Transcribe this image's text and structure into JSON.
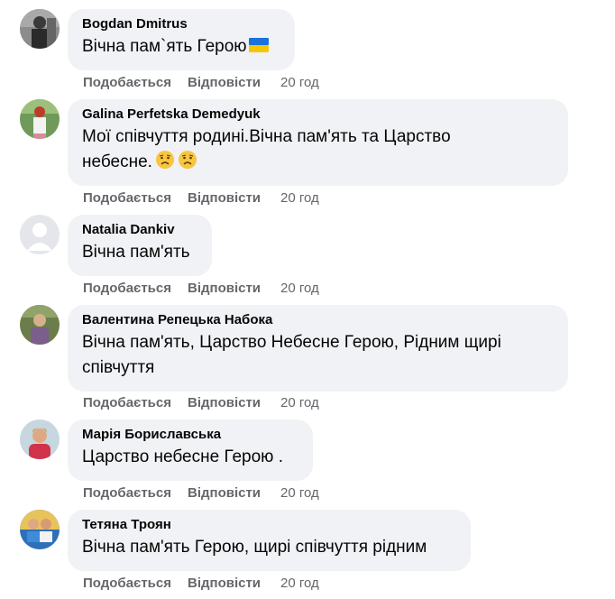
{
  "comments": [
    {
      "author": "Bogdan Dmitrus",
      "text": "Вічна пам`ять Герою",
      "emoji": "ukraine-flag",
      "like_label": "Подобається",
      "reply_label": "Відповісти",
      "time": "20 год"
    },
    {
      "author": "Galina Perfetska Demedyuk",
      "text_line1": "Мої співчуття родині.Вічна пам'ять та Царство",
      "text_line2": "небесне.",
      "emoji": "sad-face-x2",
      "like_label": "Подобається",
      "reply_label": "Відповісти",
      "time": "20 год"
    },
    {
      "author": "Natalia Dankiv",
      "text": "Вічна пам'ять",
      "like_label": "Подобається",
      "reply_label": "Відповісти",
      "time": "20 год"
    },
    {
      "author": "Валентина Репецька Набока",
      "text_line1": "Вічна пам'ять, Царство Небесне Герою, Рідним щирі",
      "text_line2": "співчуття",
      "like_label": "Подобається",
      "reply_label": "Відповісти",
      "time": "20 год"
    },
    {
      "author": "Марія Бориславська",
      "text": "Царство небесне Герою .",
      "like_label": "Подобається",
      "reply_label": "Відповісти",
      "time": "20 год"
    },
    {
      "author": "Тетяна Троян",
      "text": "Вічна пам'ять Герою, щирі співчуття рідним",
      "like_label": "Подобається",
      "reply_label": "Відповісти",
      "time": "20 год"
    }
  ],
  "colors": {
    "bubble_bg": "#f0f2f5",
    "secondary_text": "#65676b",
    "primary_text": "#050505"
  }
}
